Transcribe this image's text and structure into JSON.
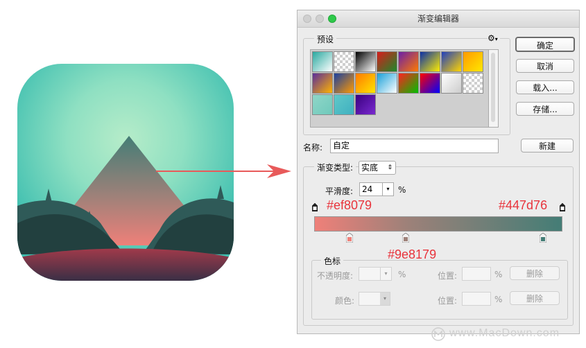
{
  "window": {
    "title": "渐变编辑器",
    "presets_label": "预设",
    "gear_icon": "gear-icon",
    "buttons": {
      "ok": "确定",
      "cancel": "取消",
      "load": "载入...",
      "save": "存储...",
      "new": "新建"
    },
    "name_label": "名称:",
    "name_value": "自定",
    "gradient_type_label": "渐变类型:",
    "gradient_type_value": "实底",
    "smoothness_label": "平滑度:",
    "smoothness_value": "24",
    "smoothness_unit": "%",
    "color_stops_label": "色标",
    "opacity_label": "不透明度:",
    "opacity_unit": "%",
    "location_label": "位置:",
    "location_unit": "%",
    "delete_label": "删除",
    "color_label": "颜色:"
  },
  "gradient": {
    "start_color": "#ef8079",
    "mid_color": "#9e8179",
    "end_color": "#447d76",
    "stops": [
      {
        "label": "#ef8079",
        "position_percent": 0
      },
      {
        "label": "#9e8179",
        "position_percent": 37
      },
      {
        "label": "#447d76",
        "position_percent": 100
      }
    ]
  },
  "presets": [
    [
      "#2aa9a0",
      "#ffffff"
    ],
    [
      "transparent"
    ],
    [
      "#000000",
      "#ffffff"
    ],
    [
      "#d81c1c",
      "#1a8a2a"
    ],
    [
      "#6b1fa8",
      "#ff7a00"
    ],
    [
      "#0a2fa8",
      "#ffee00"
    ],
    [
      "#1f3fbf",
      "#ffd400"
    ],
    [
      "#ff9a00",
      "#ffe800"
    ],
    [
      "#5a2d9a",
      "#ffb400"
    ],
    [
      "#1a3fa0",
      "#ff9a00"
    ],
    [
      "#ff7a00",
      "#ffe500"
    ],
    [
      "#1aa0d8",
      "#ffffff"
    ],
    [
      "#ff2020",
      "#00c000"
    ],
    [
      "#ff0000",
      "#0000ff"
    ],
    [
      "#ffffff",
      "#cccccc"
    ],
    [
      "transparent"
    ],
    [
      "#8fd6c8",
      "#6fc9bb"
    ],
    [
      "#5fc8c8",
      "#3fb0c0"
    ],
    [
      "#3a0080",
      "#7a2ad0"
    ]
  ],
  "watermark": "www.MacDown.com"
}
